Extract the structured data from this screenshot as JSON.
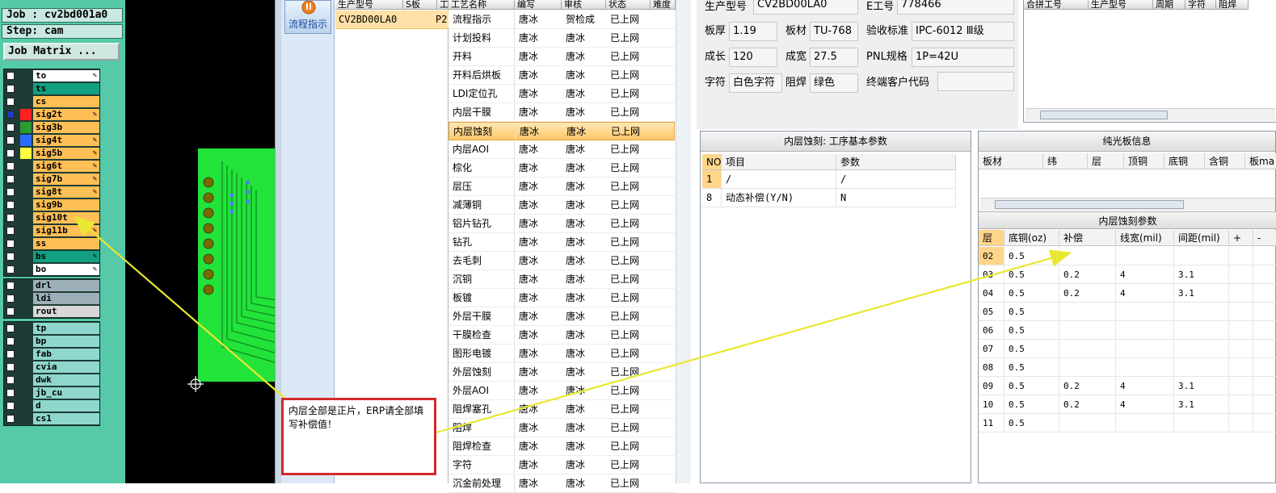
{
  "cam": {
    "job_label": "Job : cv2bd001a0",
    "step_label": "Step: cam",
    "matrix_button": "Job Matrix ...",
    "layers_signal": [
      {
        "name": "to",
        "bg": "#ffffff",
        "mark": "pen",
        "color": ""
      },
      {
        "name": "ts",
        "bg": "#139f82",
        "mark": "",
        "color": ""
      },
      {
        "name": "cs",
        "bg": "#ffbf55",
        "mark": "",
        "color": ""
      },
      {
        "name": "sig2t",
        "bg": "#ffbf55",
        "mark": "pen",
        "color": "#ff2020",
        "checked": true
      },
      {
        "name": "sig3b",
        "bg": "#ffbf55",
        "mark": "",
        "color": "#2b9a33"
      },
      {
        "name": "sig4t",
        "bg": "#ffbf55",
        "mark": "pen",
        "color": "#2a6cff"
      },
      {
        "name": "sig5b",
        "bg": "#ffbf55",
        "mark": "pen",
        "color": "#ffff40"
      },
      {
        "name": "sig6t",
        "bg": "#ffbf55",
        "mark": "pen",
        "color": ""
      },
      {
        "name": "sig7b",
        "bg": "#ffbf55",
        "mark": "pen",
        "color": ""
      },
      {
        "name": "sig8t",
        "bg": "#ffbf55",
        "mark": "pen",
        "color": ""
      },
      {
        "name": "sig9b",
        "bg": "#ffbf55",
        "mark": "",
        "color": ""
      },
      {
        "name": "sig10t",
        "bg": "#ffbf55",
        "mark": "",
        "color": ""
      },
      {
        "name": "sig11b",
        "bg": "#ffbf55",
        "mark": "pen",
        "color": ""
      },
      {
        "name": "ss",
        "bg": "#ffbf55",
        "mark": "",
        "color": ""
      },
      {
        "name": "bs",
        "bg": "#139f82",
        "mark": "pen",
        "color": ""
      },
      {
        "name": "bo",
        "bg": "#ffffff",
        "mark": "pen",
        "color": ""
      }
    ],
    "layers_drill": [
      {
        "name": "drl",
        "bg": "#9dafb8"
      },
      {
        "name": "ldi",
        "bg": "#9dafb8"
      },
      {
        "name": "rout",
        "bg": "#d8d8d8"
      }
    ],
    "layers_misc": [
      "tp",
      "bp",
      "fab",
      "cvia",
      "dwk",
      "jb_cu",
      "d",
      "cs1"
    ]
  },
  "flow": {
    "button_label": "流程指示"
  },
  "product_table": {
    "headers": [
      "生产型号",
      "S板",
      "工"
    ],
    "row": [
      "CV2BD00LA0",
      "P2"
    ]
  },
  "process_table": {
    "headers": [
      "工艺名称",
      "编写",
      "审核",
      "状态",
      "难度"
    ],
    "rows": [
      [
        "流程指示",
        "唐冰",
        "贺检成",
        "已上网"
      ],
      [
        "计划投料",
        "唐冰",
        "唐冰",
        "已上网"
      ],
      [
        "开料",
        "唐冰",
        "唐冰",
        "已上网"
      ],
      [
        "开料后烘板",
        "唐冰",
        "唐冰",
        "已上网"
      ],
      [
        "LDI定位孔",
        "唐冰",
        "唐冰",
        "已上网"
      ],
      [
        "内层干膜",
        "唐冰",
        "唐冰",
        "已上网"
      ],
      [
        "内层蚀刻",
        "唐冰",
        "唐冰",
        "已上网"
      ],
      [
        "内层AOI",
        "唐冰",
        "唐冰",
        "已上网"
      ],
      [
        "棕化",
        "唐冰",
        "唐冰",
        "已上网"
      ],
      [
        "层压",
        "唐冰",
        "唐冰",
        "已上网"
      ],
      [
        "减薄铜",
        "唐冰",
        "唐冰",
        "已上网"
      ],
      [
        "铝片钻孔",
        "唐冰",
        "唐冰",
        "已上网"
      ],
      [
        "钻孔",
        "唐冰",
        "唐冰",
        "已上网"
      ],
      [
        "去毛刺",
        "唐冰",
        "唐冰",
        "已上网"
      ],
      [
        "沉铜",
        "唐冰",
        "唐冰",
        "已上网"
      ],
      [
        "板镀",
        "唐冰",
        "唐冰",
        "已上网"
      ],
      [
        "外层干膜",
        "唐冰",
        "唐冰",
        "已上网"
      ],
      [
        "干膜检查",
        "唐冰",
        "唐冰",
        "已上网"
      ],
      [
        "图形电镀",
        "唐冰",
        "唐冰",
        "已上网"
      ],
      [
        "外层蚀刻",
        "唐冰",
        "唐冰",
        "已上网"
      ],
      [
        "外层AOI",
        "唐冰",
        "唐冰",
        "已上网"
      ],
      [
        "阻焊塞孔",
        "唐冰",
        "唐冰",
        "已上网"
      ],
      [
        "阻焊",
        "唐冰",
        "唐冰",
        "已上网"
      ],
      [
        "阻焊检查",
        "唐冰",
        "唐冰",
        "已上网"
      ],
      [
        "字符",
        "唐冰",
        "唐冰",
        "已上网"
      ],
      [
        "沉金前处理",
        "唐冰",
        "唐冰",
        "已上网"
      ]
    ],
    "active_index": 6
  },
  "info": {
    "model_label": "生产型号",
    "model_value": "CV2BD00LA0",
    "eno_label": "E工号",
    "eno_value": "778466",
    "thickness_label": "板厚",
    "thickness_value": "1.19",
    "material_label": "板材",
    "material_value": "TU-768",
    "standard_label": "验收标准",
    "standard_value": "IPC-6012 Ⅲ级",
    "length_label": "成长",
    "length_value": "120",
    "width_label": "成宽",
    "width_value": "27.5",
    "pnl_label": "PNL规格",
    "pnl_value": "1P=42U",
    "char_label": "字符",
    "char_value": "白色字符",
    "mask_label": "阻焊",
    "mask_value": "绿色",
    "endcode_label": "终端客户代码",
    "endcode_value": ""
  },
  "combine": {
    "headers": [
      "合拼工号",
      "生产型号",
      "周期",
      "字符",
      "阻焊"
    ]
  },
  "params": {
    "title": "内层蚀刻: 工序基本参数",
    "headers": [
      "NO",
      "项目",
      "参数"
    ],
    "rows": [
      [
        "1",
        "/",
        "/"
      ],
      [
        "8",
        "动态补偿(Y/N)",
        "N"
      ]
    ]
  },
  "board": {
    "title": "纯光板信息",
    "headers": [
      "板材",
      "纬",
      "层",
      "顶铜",
      "底铜",
      "含铜",
      "板ma"
    ]
  },
  "etch": {
    "title": "内层蚀刻参数",
    "headers": [
      "层",
      "底铜(oz)",
      "补偿",
      "线宽(mil)",
      "间距(mil)",
      "+",
      "-"
    ],
    "rows": [
      [
        "02",
        "0.5",
        "",
        "",
        ""
      ],
      [
        "03",
        "0.5",
        "0.2",
        "4",
        "3.1"
      ],
      [
        "04",
        "0.5",
        "0.2",
        "4",
        "3.1"
      ],
      [
        "05",
        "0.5",
        "",
        "",
        ""
      ],
      [
        "06",
        "0.5",
        "",
        "",
        ""
      ],
      [
        "07",
        "0.5",
        "",
        "",
        ""
      ],
      [
        "08",
        "0.5",
        "",
        "",
        ""
      ],
      [
        "09",
        "0.5",
        "0.2",
        "4",
        "3.1"
      ],
      [
        "10",
        "0.5",
        "0.2",
        "4",
        "3.1"
      ],
      [
        "11",
        "0.5",
        "",
        "",
        ""
      ]
    ]
  },
  "annotation": {
    "text": "内层全部是正片，ERP请全部填写补偿值！"
  }
}
